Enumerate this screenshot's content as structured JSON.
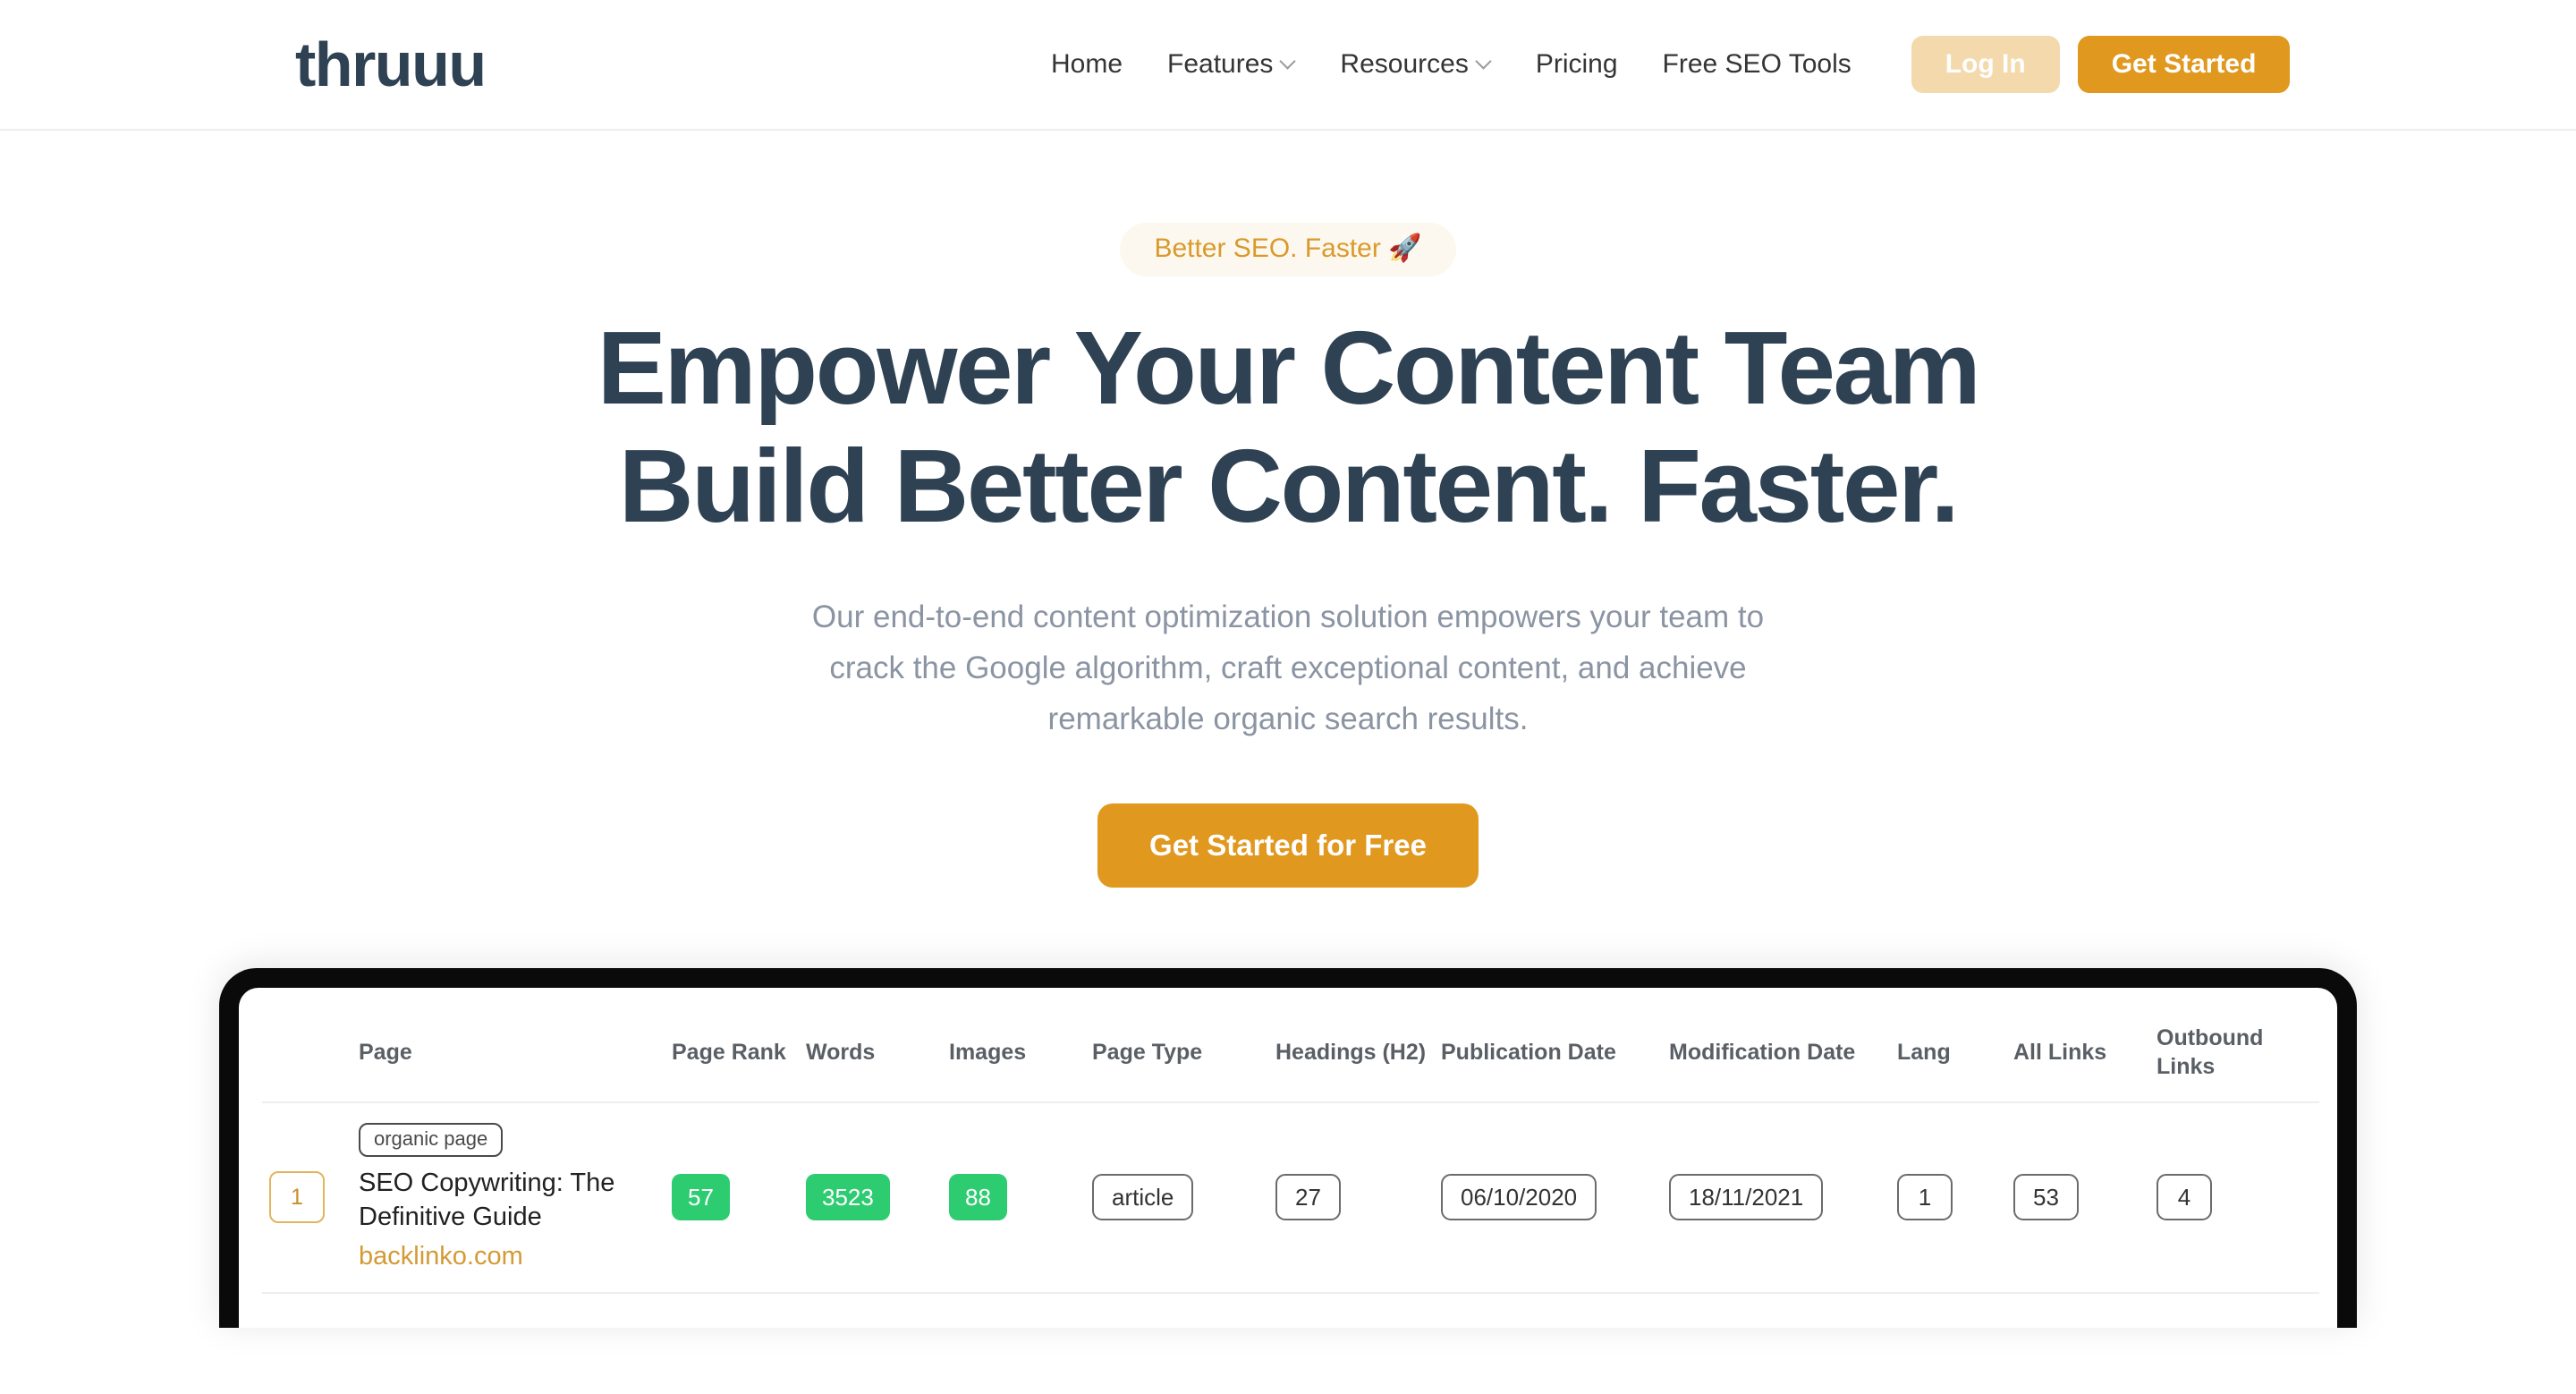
{
  "header": {
    "logo": "thruuu",
    "nav": [
      {
        "label": "Home",
        "has_chevron": false
      },
      {
        "label": "Features",
        "has_chevron": true
      },
      {
        "label": "Resources",
        "has_chevron": true
      },
      {
        "label": "Pricing",
        "has_chevron": false
      },
      {
        "label": "Free SEO Tools",
        "has_chevron": false
      }
    ],
    "login_label": "Log In",
    "get_started_label": "Get Started"
  },
  "hero": {
    "pill": "Better SEO. Faster 🚀",
    "headline_line1": "Empower Your Content Team",
    "headline_line2": "Build Better Content. Faster.",
    "subtitle_line1": "Our end-to-end content optimization solution empowers your team to",
    "subtitle_line2": "crack the Google algorithm, craft exceptional content, and achieve",
    "subtitle_line3": "remarkable organic search results.",
    "cta_label": "Get Started for Free"
  },
  "mockup": {
    "table": {
      "headers": {
        "rank": "",
        "page": "Page",
        "page_rank": "Page Rank",
        "words": "Words",
        "images": "Images",
        "page_type": "Page Type",
        "headings": "Headings (H2)",
        "publication_date": "Publication Date",
        "modification_date": "Modification Date",
        "lang": "Lang",
        "all_links": "All Links",
        "outbound_links": "Outbound Links"
      },
      "rows": [
        {
          "rank": "1",
          "tag": "organic page",
          "title": "SEO Copywriting: The Definitive Guide",
          "domain": "backlinko.com",
          "page_rank": "57",
          "words": "3523",
          "images": "88",
          "page_type": "article",
          "headings": "27",
          "publication_date": "06/10/2020",
          "modification_date": "18/11/2021",
          "lang": "1",
          "all_links": "53",
          "outbound_links": "4"
        }
      ]
    }
  },
  "colors": {
    "accent_orange": "#e0981f",
    "login_tan": "#f3d9ab",
    "heading_navy": "#2f4254",
    "subtitle_gray": "#8b94a3",
    "badge_green": "#2ecc71",
    "pill_bg": "#fcf8ef",
    "pill_text": "#d99a2b"
  }
}
